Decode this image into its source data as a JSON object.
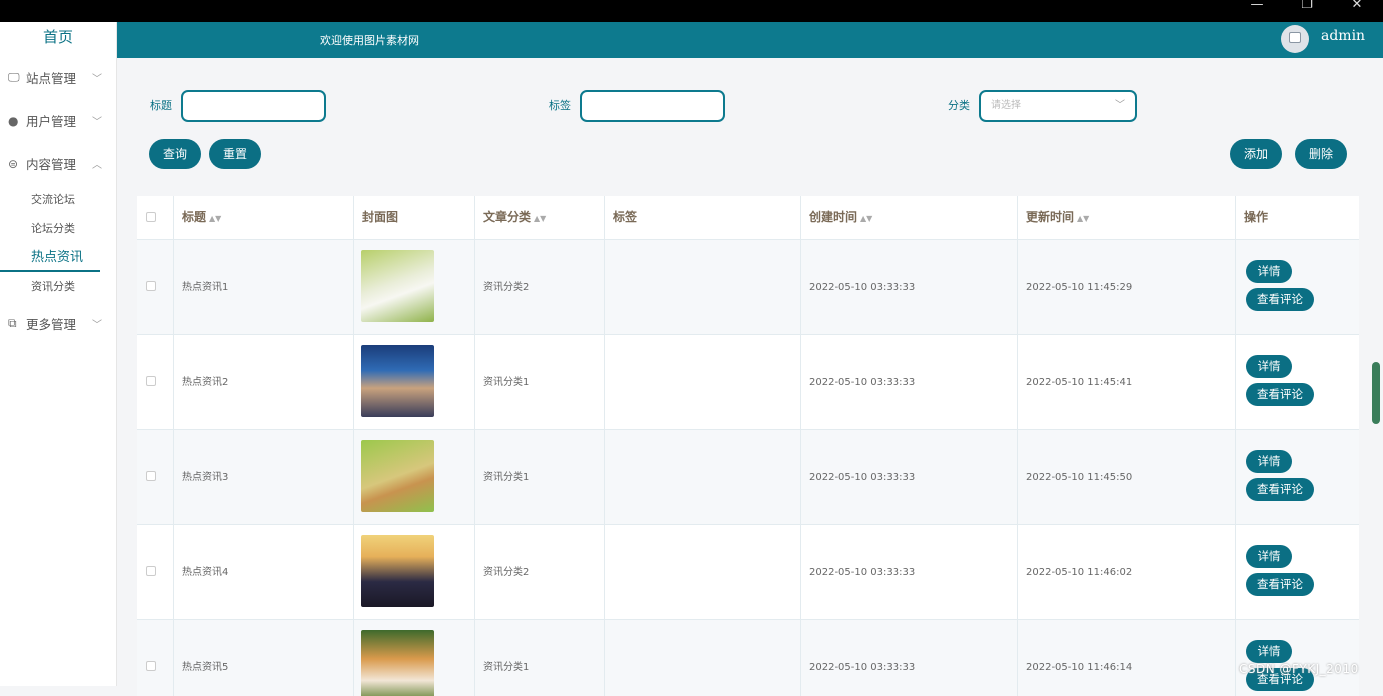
{
  "window": {
    "minimize": "—",
    "restore": "❐",
    "close": "✕"
  },
  "sidebar": {
    "home": "首页",
    "menus": [
      {
        "label": "站点管理",
        "icon": "monitor-icon"
      },
      {
        "label": "用户管理",
        "icon": "user-icon"
      },
      {
        "label": "内容管理",
        "icon": "message-icon"
      },
      {
        "label": "更多管理",
        "icon": "copy-icon"
      }
    ],
    "content_sub": [
      "交流论坛",
      "论坛分类",
      "热点资讯",
      "资讯分类"
    ]
  },
  "header": {
    "welcome": "欢迎使用图片素材网",
    "user": "admin"
  },
  "filters": {
    "title_label": "标题",
    "tag_label": "标签",
    "category_label": "分类",
    "category_placeholder": "请选择",
    "query_button": "查询",
    "reset_button": "重置",
    "add_button": "添加",
    "delete_button": "删除"
  },
  "table": {
    "columns": [
      "标题",
      "封面图",
      "文章分类",
      "标签",
      "创建时间",
      "更新时间",
      "操作"
    ],
    "detail_label": "详情",
    "comment_label": "查看评论",
    "rows": [
      {
        "title": "热点资讯1",
        "category": "资讯分类2",
        "tag": "",
        "created": "2022-05-10 03:33:33",
        "updated": "2022-05-10 11:45:29"
      },
      {
        "title": "热点资讯2",
        "category": "资讯分类1",
        "tag": "",
        "created": "2022-05-10 03:33:33",
        "updated": "2022-05-10 11:45:41"
      },
      {
        "title": "热点资讯3",
        "category": "资讯分类1",
        "tag": "",
        "created": "2022-05-10 03:33:33",
        "updated": "2022-05-10 11:45:50"
      },
      {
        "title": "热点资讯4",
        "category": "资讯分类2",
        "tag": "",
        "created": "2022-05-10 03:33:33",
        "updated": "2022-05-10 11:46:02"
      },
      {
        "title": "热点资讯5",
        "category": "资讯分类1",
        "tag": "",
        "created": "2022-05-10 03:33:33",
        "updated": "2022-05-10 11:46:14"
      }
    ]
  },
  "watermark": "CSDN @FYKJ_2010",
  "colors": {
    "accent": "#0d7a8e",
    "button": "#0b6f84"
  }
}
